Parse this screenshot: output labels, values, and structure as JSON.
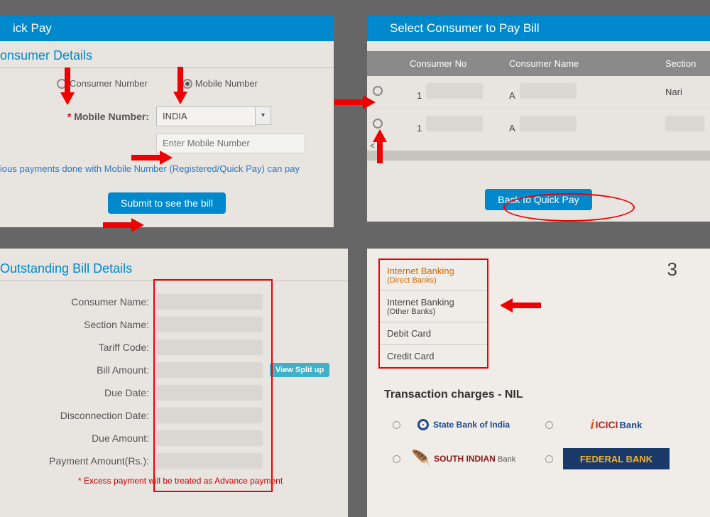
{
  "quickpay": {
    "header": "ick Pay",
    "section": "onsumer Details",
    "radios": {
      "consumer": "Consumer Number",
      "mobile": "Mobile Number"
    },
    "mobile_label": "Mobile Number:",
    "country": "INDIA",
    "placeholder": "Enter Mobile Number",
    "info": "ious payments done with Mobile Number (Registered/Quick Pay) can pay",
    "submit": "Submit to see the bill"
  },
  "selectconsumer": {
    "header": "Select Consumer to Pay Bill",
    "cols": {
      "no": "Consumer No",
      "name": "Consumer Name",
      "section": "Section"
    },
    "rows": [
      {
        "no": "1",
        "name": "A",
        "section": "Nari"
      },
      {
        "no": "1",
        "name": "A",
        "section": ""
      }
    ],
    "back": "Back to Quick Pay"
  },
  "bill": {
    "section": "Outstanding Bill Details",
    "labels": {
      "consumer": "Consumer Name:",
      "section": "Section Name:",
      "tariff": "Tariff Code:",
      "amount": "Bill Amount:",
      "due": "Due Date:",
      "disc": "Disconnection Date:",
      "dueamt": "Due Amount:",
      "payamt": "Payment Amount(Rs.):"
    },
    "splitup": "View Split up",
    "note": "* Excess payment will be treated as Advance payment"
  },
  "payment": {
    "step": "3",
    "tabs": {
      "ib_direct": "Internet Banking",
      "ib_direct_sub": "(Direct Banks)",
      "ib_other": "Internet Banking",
      "ib_other_sub": "(Other Banks)",
      "debit": "Debit Card",
      "credit": "Credit Card"
    },
    "charges": "Transaction charges - NIL",
    "banks": {
      "sbi": "State Bank of India",
      "icici": "ICICI Bank",
      "south": "SOUTH INDIAN",
      "south_sub": "Bank",
      "federal": "FEDERAL BANK"
    }
  }
}
